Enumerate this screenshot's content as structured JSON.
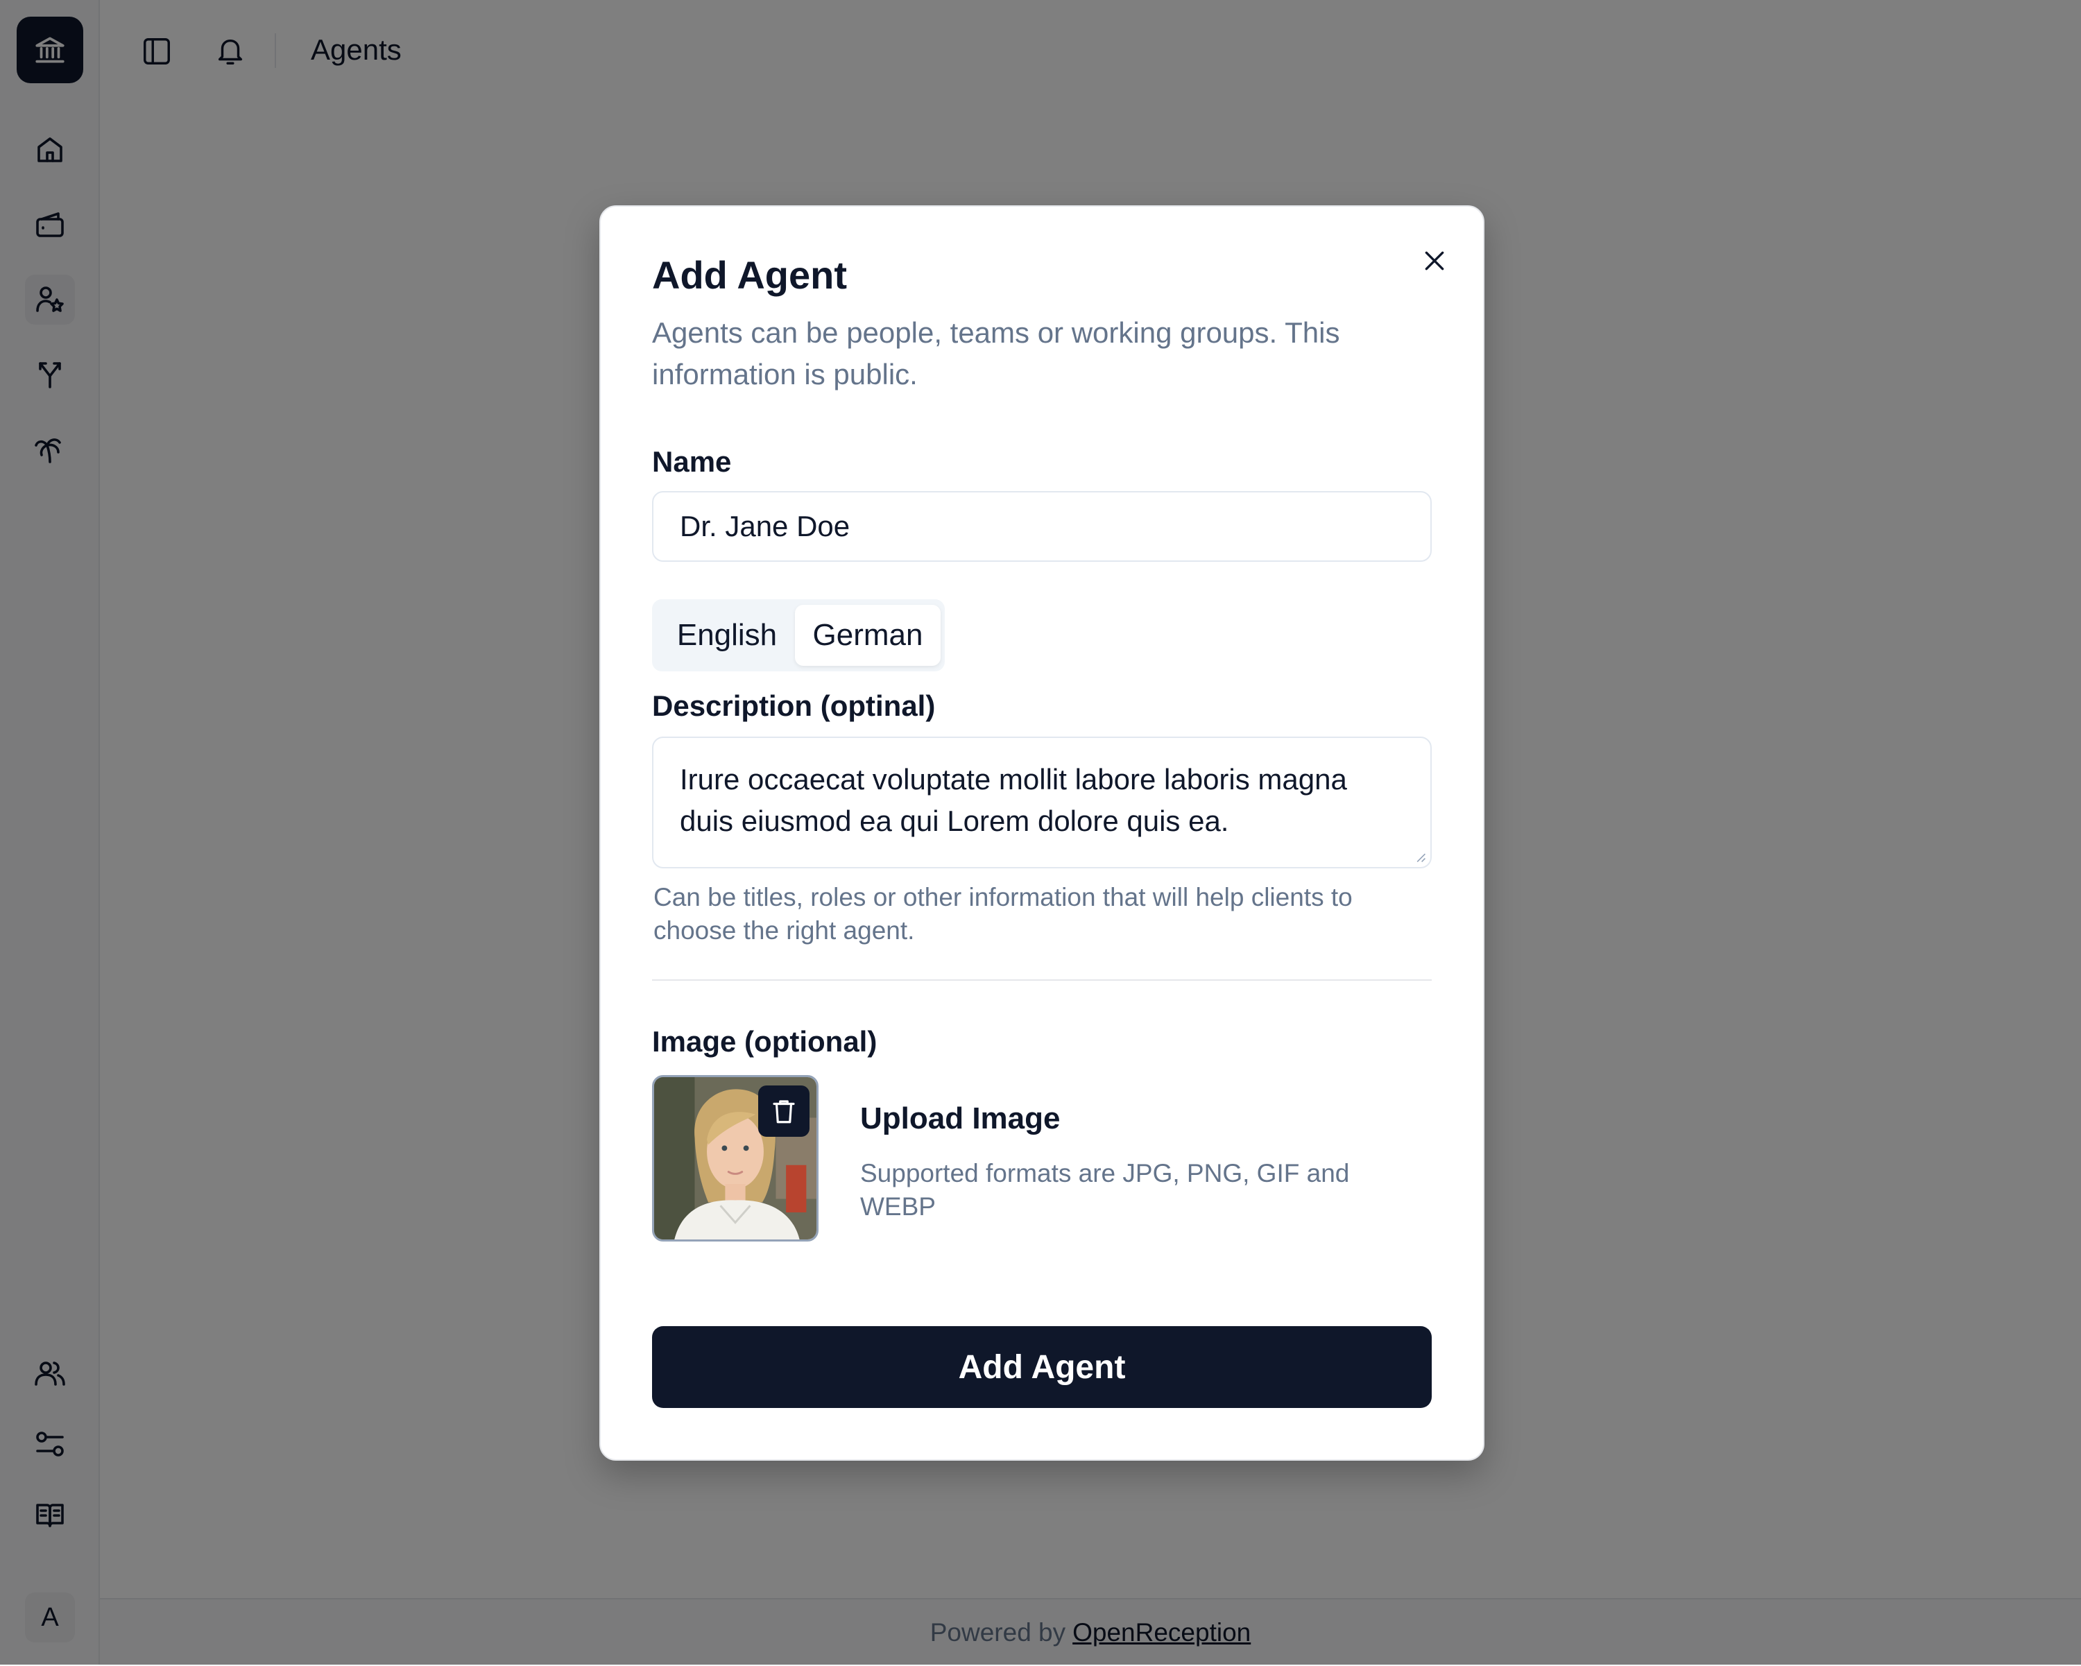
{
  "header": {
    "title": "Agents"
  },
  "sidebar": {
    "items": [
      "home-icon",
      "wallet-icon",
      "agents-icon",
      "split-icon",
      "palm-tree-icon"
    ],
    "bottom_items": [
      "users-icon",
      "settings-sliders-icon",
      "book-icon"
    ],
    "avatar_initial": "A"
  },
  "footer": {
    "prefix": "Powered by",
    "link": "OpenReception"
  },
  "modal": {
    "title": "Add Agent",
    "description": "Agents can be people, teams or working groups. This information is public.",
    "name_label": "Name",
    "name_value": "Dr. Jane Doe",
    "tabs": [
      {
        "label": "English",
        "active": false
      },
      {
        "label": "German",
        "active": true
      }
    ],
    "description_label": "Description (optinal)",
    "description_value": "Irure occaecat voluptate mollit labore laboris magna duis eiusmod ea qui Lorem dolore quis ea.",
    "description_hint": "Can be titles, roles or other information that will help clients to choose the right agent.",
    "image_label": "Image (optional)",
    "upload_title": "Upload Image",
    "upload_hint": "Supported formats are JPG, PNG, GIF and WEBP",
    "submit_label": "Add Agent"
  },
  "colors": {
    "primary": "#0f172a",
    "muted_text": "#64748b",
    "border": "#e2e8f0",
    "overlay": "rgba(0,0,0,0.5)"
  }
}
